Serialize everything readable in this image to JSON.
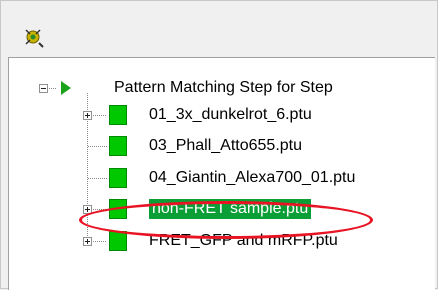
{
  "toolbar": {
    "button_icon": "settings-wand-icon"
  },
  "tree": {
    "root": {
      "label": "Pattern Matching Step for Step",
      "expanded": true,
      "icon": "play-arrow-icon"
    },
    "items": [
      {
        "label": "01_3x_dunkelrot_6.ptu",
        "has_children": true,
        "selected": false
      },
      {
        "label": "03_Phall_Atto655.ptu",
        "has_children": false,
        "selected": false
      },
      {
        "label": "04_Giantin_Alexa700_01.ptu",
        "has_children": false,
        "selected": false
      },
      {
        "label": "non-FRET sample.ptu",
        "has_children": true,
        "selected": true
      },
      {
        "label": "FRET_GFP and mRFP.ptu",
        "has_children": true,
        "selected": false
      }
    ]
  },
  "colors": {
    "status_green": "#00c800",
    "selection_green": "#0a9e36",
    "highlight_red": "#e81423",
    "root_arrow": "#1aa31a"
  }
}
